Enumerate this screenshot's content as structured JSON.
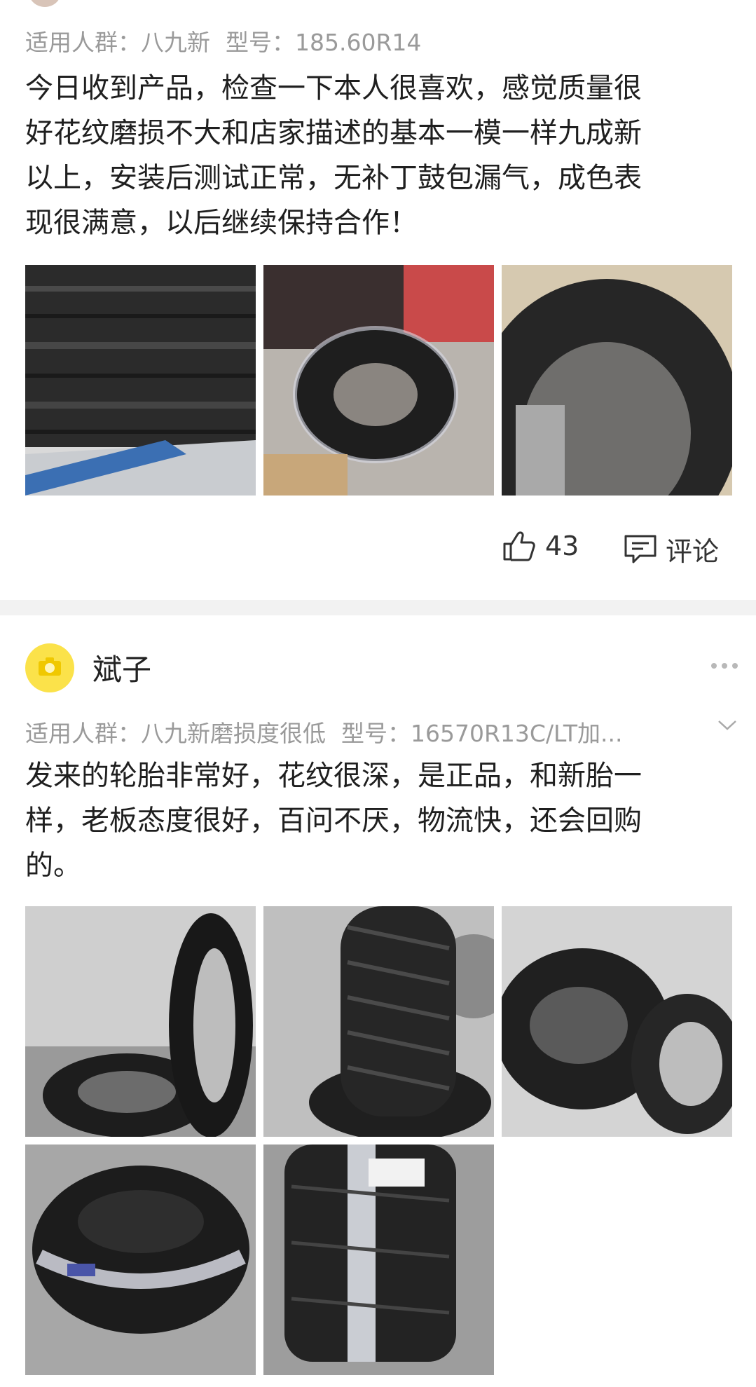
{
  "review1": {
    "spec_crowd": "适用人群：八九新",
    "spec_model": "型号：185.60R14",
    "body_lines": [
      "今日收到产品，检查一下本人很喜欢，感觉质量很",
      "好花纹磨损不大和店家描述的基本一模一样九成新",
      "以上，安装后测试正常，无补丁鼓包漏气，成色表",
      "现很满意，以后继续保持合作！"
    ],
    "photos": [
      "tire-tread-closeup",
      "tire-wrapped-in-plastic",
      "tire-sidewall"
    ],
    "like_count": "43",
    "comment_label": "评论"
  },
  "review2": {
    "username": "斌子",
    "spec_crowd": "适用人群：八九新磨损度很低",
    "spec_model": "型号：16570R13C/LT加...",
    "body_lines": [
      "发来的轮胎非常好，花纹很深，是正品，和新胎一",
      "样，老板态度很好，百问不厌，物流快，还会回购",
      "的。"
    ],
    "photos": [
      "tires-stacked-leaning",
      "tire-standing-tread",
      "two-tires-side-by-side",
      "tire-wrapped-lying",
      "tire-wrapped-standing"
    ]
  },
  "colors": {
    "avatar": "#fbe24a",
    "divider": "#f2f2f2",
    "spec_text": "#9a9a9a"
  }
}
